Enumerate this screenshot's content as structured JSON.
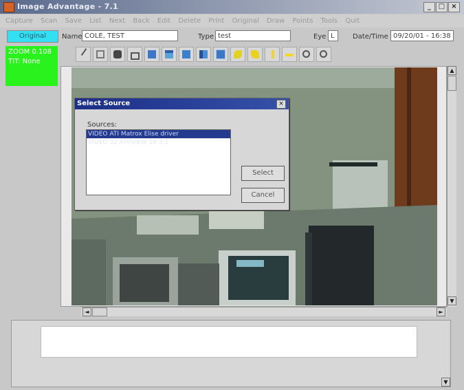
{
  "window": {
    "title": "Image Advantage - 7.1",
    "controls": [
      "_",
      "□",
      "×"
    ]
  },
  "menu": [
    "Capture",
    "Scan",
    "Save",
    "List",
    "Next",
    "Back",
    "Edit",
    "Delete",
    "Print",
    "Original",
    "Draw",
    "Points",
    "Tools",
    "Quit"
  ],
  "header": {
    "mode_label": "Original",
    "name_label": "Name",
    "name_value": "COLE, TEST",
    "type_label": "Type",
    "type_value": "test",
    "eye_label": "Eye",
    "eye_value": "L",
    "datetime_label": "Date/Time",
    "datetime_value": "09/20/01 - 16:38"
  },
  "zoom_panel": {
    "zoom_text": "ZOOM 0.108",
    "tilt_text": "TIT: None"
  },
  "toolbar_icons": [
    "draw-icon",
    "copy-icon",
    "camera-icon",
    "print-icon",
    "monitor-icon",
    "window-icon",
    "text-icon",
    "compare-icon",
    "grid-icon",
    "rotate-left-icon",
    "rotate-right-icon",
    "flip-icon",
    "brightness-icon",
    "zoom-in-icon",
    "zoom-out-icon"
  ],
  "dialog": {
    "title": "Select Source",
    "close": "×",
    "sources_label": "Sources:",
    "sources": [
      "VIDEO ATI Matrox Elise driver",
      "VIDEO 32 ATI/VIEW 18.3.1"
    ],
    "select_button": "Select",
    "cancel_button": "Cancel"
  },
  "scroll": {
    "up": "▲",
    "down": "▼",
    "left": "◄",
    "right": "►"
  },
  "colors": {
    "mode_bg": "#33e0f3",
    "zoom_bg": "#29f21d",
    "selection": "#243a8f",
    "title_bar": "#5a6a8c"
  }
}
